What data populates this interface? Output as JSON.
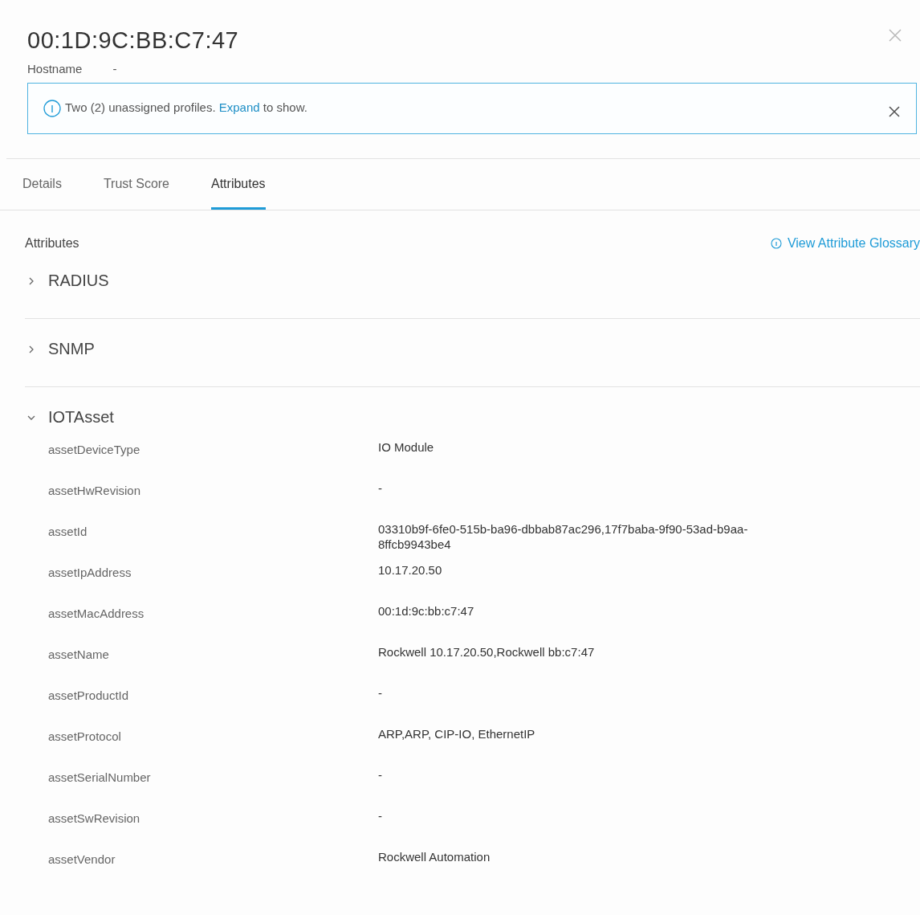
{
  "header": {
    "title": "00:1D:9C:BB:C7:47",
    "hostname_label": "Hostname",
    "hostname_value": "-"
  },
  "alert": {
    "before": "Two (2) unassigned profiles. ",
    "link": "Expand",
    "after": " to show."
  },
  "tabs": [
    {
      "label": "Details",
      "selected": false
    },
    {
      "label": "Trust Score",
      "selected": false
    },
    {
      "label": "Attributes",
      "selected": true
    }
  ],
  "attributes_panel": {
    "heading": "Attributes",
    "glossary_link": "View Attribute Glossary",
    "sections": [
      {
        "name": "RADIUS",
        "expanded": false
      },
      {
        "name": "SNMP",
        "expanded": false
      },
      {
        "name": "IOTAsset",
        "expanded": true,
        "rows": [
          {
            "name": "assetDeviceType",
            "value": "IO Module"
          },
          {
            "name": "assetHwRevision",
            "value": "-"
          },
          {
            "name": "assetId",
            "value": "03310b9f-6fe0-515b-ba96-dbbab87ac296,17f7baba-9f90-53ad-b9aa-8ffcb9943be4"
          },
          {
            "name": "assetIpAddress",
            "value": "10.17.20.50"
          },
          {
            "name": "assetMacAddress",
            "value": "00:1d:9c:bb:c7:47"
          },
          {
            "name": "assetName",
            "value": "Rockwell 10.17.20.50,Rockwell bb:c7:47"
          },
          {
            "name": "assetProductId",
            "value": "-"
          },
          {
            "name": "assetProtocol",
            "value": "ARP,ARP, CIP-IO, EthernetIP"
          },
          {
            "name": "assetSerialNumber",
            "value": "-"
          },
          {
            "name": "assetSwRevision",
            "value": "-"
          },
          {
            "name": "assetVendor",
            "value": "Rockwell Automation"
          }
        ]
      }
    ]
  }
}
